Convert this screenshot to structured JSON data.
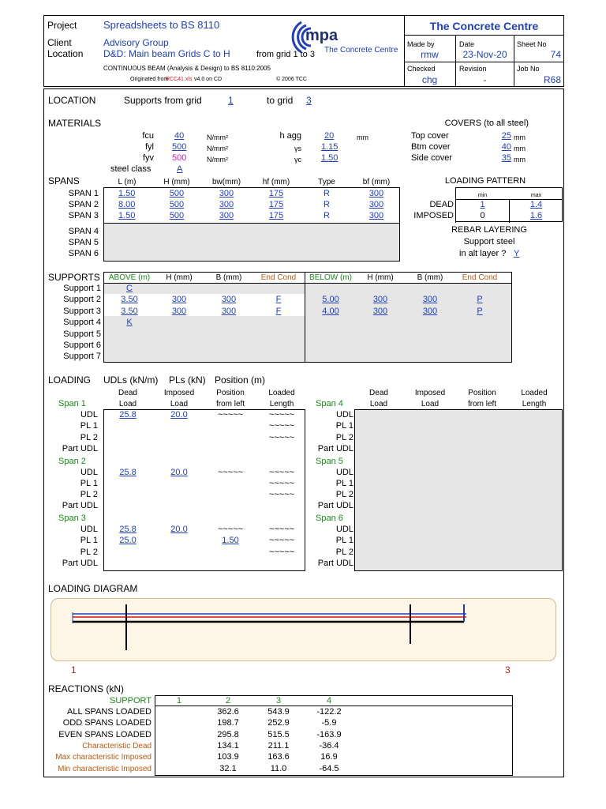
{
  "header": {
    "project_label": "Project",
    "project": "Spreadsheets to BS 8110",
    "client_label": "Client",
    "client": "Advisory Group",
    "location_label": "Location",
    "location": "D&D: Main beam Grids C to H",
    "location_from": "from grid 1 to 3",
    "subtitle": "CONTINUOUS BEAM (Analysis & Design) to BS 8110:2005",
    "originated_prefix": "Originated from",
    "originated_file": "RCC41.xls",
    "version": "v4.0 on CD",
    "copyright": "© 2006 TCC",
    "logo_text": "mpa",
    "logo_sub": "The Concrete Centre",
    "org": "The Concrete Centre",
    "made_by_label": "Made by",
    "made_by": "rmw",
    "date_label": "Date",
    "date": "23-Nov-20",
    "sheet_label": "Sheet No",
    "sheet": "74",
    "checked_label": "Checked",
    "checked": "chg",
    "revision_label": "Revision",
    "revision": "-",
    "job_label": "Job No",
    "job": "R68"
  },
  "location_row": {
    "label": "LOCATION",
    "from_text": "Supports from grid",
    "from_val": "1",
    "to_text": "to grid",
    "to_val": "3"
  },
  "materials": {
    "label": "MATERIALS",
    "fcu_label": "fcu",
    "fcu": "40",
    "fcu_unit": "N/mm²",
    "fy_label": "fyl",
    "fy": "500",
    "fy_unit": "N/mm²",
    "fyv_label": "fyv",
    "fyv": "500",
    "fyv_unit": "N/mm²",
    "hagg_label": "h agg",
    "hagg": "20",
    "hagg_unit": "mm",
    "gs_label": "γs",
    "gs": "1.15",
    "gc_label": "γc",
    "gc": "1.50",
    "steel_class_label": "steel class",
    "steel_class": "A",
    "covers_title": "COVERS (to all steel)",
    "top_cover_label": "Top cover",
    "top_cover": "25",
    "btm_cover_label": "Btm cover",
    "btm_cover": "40",
    "side_cover_label": "Side cover",
    "side_cover": "35",
    "cover_unit": "mm"
  },
  "spans": {
    "label": "SPANS",
    "headers": [
      "L (m)",
      "H (mm)",
      "bw(mm)",
      "hf (mm)",
      "Type",
      "bf (mm)"
    ],
    "rows": [
      {
        "name": "SPAN 1",
        "vals": [
          "1.50",
          "500",
          "300",
          "175",
          "R",
          "300"
        ]
      },
      {
        "name": "SPAN 2",
        "vals": [
          "8.00",
          "500",
          "300",
          "175",
          "R",
          "300"
        ]
      },
      {
        "name": "SPAN 3",
        "vals": [
          "1.50",
          "500",
          "300",
          "175",
          "R",
          "300"
        ]
      },
      {
        "name": "SPAN 4",
        "vals": [
          "",
          "",
          "",
          "",
          "",
          ""
        ]
      },
      {
        "name": "SPAN 5",
        "vals": [
          "",
          "",
          "",
          "",
          "",
          ""
        ]
      },
      {
        "name": "SPAN 6",
        "vals": [
          "",
          "",
          "",
          "",
          "",
          ""
        ]
      }
    ]
  },
  "loading_pattern": {
    "title": "LOADING PATTERN",
    "min_label": "min",
    "max_label": "max",
    "dead_label": "DEAD",
    "dead_min": "1",
    "dead_max": "1.4",
    "imposed_label": "IMPOSED",
    "imposed_min": "0",
    "imposed_max": "1.6",
    "rebar_title": "REBAR LAYERING",
    "support_steel": "Support steel",
    "alt_layer": "in alt layer ?",
    "alt_layer_val": "Y"
  },
  "supports": {
    "label": "SUPPORTS",
    "above_label": "ABOVE (m)",
    "h_label": "H (mm)",
    "b_label": "B (mm)",
    "end_label": "End Cond",
    "below_label": "BELOW (m)",
    "rows": [
      {
        "name": "Support 1",
        "above": "C",
        "ah": "",
        "ab": "",
        "ae": "",
        "below": "",
        "bh": "",
        "bb": "",
        "be": ""
      },
      {
        "name": "Support 2",
        "above": "3.50",
        "ah": "300",
        "ab": "300",
        "ae": "F",
        "below": "5.00",
        "bh": "300",
        "bb": "300",
        "be": "P"
      },
      {
        "name": "Support 3",
        "above": "3.50",
        "ah": "300",
        "ab": "300",
        "ae": "F",
        "below": "4.00",
        "bh": "300",
        "bb": "300",
        "be": "P"
      },
      {
        "name": "Support 4",
        "above": "K",
        "ah": "",
        "ab": "",
        "ae": "",
        "below": "",
        "bh": "",
        "bb": "",
        "be": ""
      },
      {
        "name": "Support 5",
        "above": "",
        "ah": "",
        "ab": "",
        "ae": "",
        "below": "",
        "bh": "",
        "bb": "",
        "be": ""
      },
      {
        "name": "Support 6",
        "above": "",
        "ah": "",
        "ab": "",
        "ae": "",
        "below": "",
        "bh": "",
        "bb": "",
        "be": ""
      },
      {
        "name": "Support 7",
        "above": "",
        "ah": "",
        "ab": "",
        "ae": "",
        "below": "",
        "bh": "",
        "bb": "",
        "be": ""
      }
    ]
  },
  "loading": {
    "label": "LOADING",
    "udl_units": "UDLs (kN/m)",
    "pl_units": "PLs (kN)",
    "pos_units": "Position (m)",
    "h_dead1": "Dead",
    "h_dead2": "Load",
    "h_imp1": "Imposed",
    "h_imp2": "Load",
    "h_pos1": "Position",
    "h_pos2": "from left",
    "h_len1": "Loaded",
    "h_len2": "Length",
    "row_labels": [
      "UDL",
      "PL 1",
      "PL 2",
      "Part UDL"
    ],
    "left_spans": [
      {
        "name": "Span 1",
        "rows": [
          [
            "25.8",
            "20.0",
            "~~~~~",
            "~~~~~"
          ],
          [
            "",
            "",
            "",
            "~~~~~"
          ],
          [
            "",
            "",
            "",
            "~~~~~"
          ],
          [
            "",
            "",
            "",
            ""
          ]
        ]
      },
      {
        "name": "Span 2",
        "rows": [
          [
            "25.8",
            "20.0",
            "~~~~~",
            "~~~~~"
          ],
          [
            "",
            "",
            "",
            "~~~~~"
          ],
          [
            "",
            "",
            "",
            "~~~~~"
          ],
          [
            "",
            "",
            "",
            ""
          ]
        ]
      },
      {
        "name": "Span 3",
        "rows": [
          [
            "25.8",
            "20.0",
            "~~~~~",
            "~~~~~"
          ],
          [
            "25.0",
            "",
            "1.50",
            "~~~~~"
          ],
          [
            "",
            "",
            "",
            "~~~~~"
          ],
          [
            "",
            "",
            "",
            ""
          ]
        ]
      }
    ],
    "right_spans": [
      {
        "name": "Span 4"
      },
      {
        "name": "Span 5"
      },
      {
        "name": "Span 6"
      }
    ]
  },
  "diagram": {
    "label": "LOADING DIAGRAM",
    "left_grid": "1",
    "right_grid": "3"
  },
  "reactions": {
    "label": "REACTIONS (kN)",
    "support_label": "SUPPORT",
    "cols": [
      "1",
      "2",
      "3",
      "4"
    ],
    "rows": [
      {
        "name": "ALL SPANS LOADED",
        "cls": "",
        "vals": [
          "",
          "362.6",
          "543.9",
          "-122.2"
        ]
      },
      {
        "name": "ODD SPANS LOADED",
        "cls": "",
        "vals": [
          "",
          "198.7",
          "252.9",
          "-5.9"
        ]
      },
      {
        "name": "EVEN SPANS LOADED",
        "cls": "",
        "vals": [
          "",
          "295.8",
          "515.5",
          "-163.9"
        ]
      },
      {
        "name": "Characteristic Dead",
        "cls": "orange",
        "vals": [
          "",
          "134.1",
          "211.1",
          "-36.4"
        ]
      },
      {
        "name": "Max characteristic Imposed",
        "cls": "orange",
        "vals": [
          "",
          "103.9",
          "163.6",
          "16.9"
        ]
      },
      {
        "name": "Min characteristic Imposed",
        "cls": "orange",
        "vals": [
          "",
          "32.1",
          "11.0",
          "-64.5"
        ]
      }
    ]
  }
}
